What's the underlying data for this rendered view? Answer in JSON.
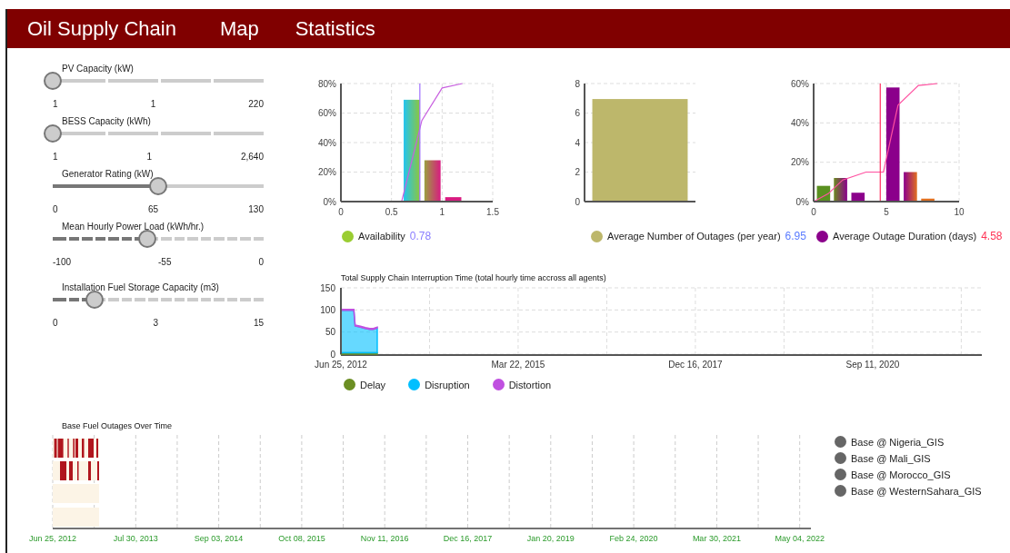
{
  "header": {
    "title": "Oil Supply Chain",
    "nav": [
      "Map",
      "Statistics"
    ]
  },
  "sliders": [
    {
      "label": "PV Capacity (kW)",
      "kind": "segmented",
      "level": 0,
      "min": "1",
      "mid": "1",
      "max": "220"
    },
    {
      "label": "BESS Capacity (kWh)",
      "kind": "segmented",
      "level": 0,
      "min": "1",
      "mid": "1",
      "max": "2,640"
    },
    {
      "label": "Generator Rating (kW)",
      "kind": "plain",
      "level": 0.5,
      "min": "0",
      "mid": "65",
      "max": "130"
    },
    {
      "label": "Mean Hourly Power Load (kWh/hr.)",
      "kind": "dashed",
      "level": 0.45,
      "min": "-100",
      "mid": "-55",
      "max": "0"
    },
    {
      "label": "Installation Fuel Storage Capacity (m3)",
      "kind": "dashed",
      "level": 0.2,
      "min": "0",
      "mid": "3",
      "max": "15"
    }
  ],
  "histograms": [
    {
      "legend": {
        "label": "Availability",
        "color": "#9acd32",
        "value": {
          "text": "0.78",
          "color": "#8a7dff"
        }
      },
      "chart_data": {
        "type": "bar",
        "xlim": [
          0,
          1.5
        ],
        "ylim": [
          0,
          80
        ],
        "xticks": [
          0,
          0.5,
          1,
          1.5
        ],
        "yticks": [
          {
            "value": 0,
            "label": "0%"
          },
          {
            "value": 20,
            "label": "20%"
          },
          {
            "value": 40,
            "label": "40%"
          },
          {
            "value": 60,
            "label": "60%"
          },
          {
            "value": 80,
            "label": "80%"
          }
        ],
        "grid": true,
        "series": [
          {
            "type": "bar",
            "x": [
              0.7,
              0.905,
              1.11
            ],
            "values": [
              69,
              28,
              3
            ]
          },
          {
            "type": "line",
            "color": "#c860e0",
            "x": [
              0.6,
              0.8,
              1.0,
              1.2
            ],
            "values": [
              0,
              55,
              77,
              80
            ]
          }
        ],
        "ref_lines": [
          {
            "axis": "x",
            "value": 0.78,
            "color": "#a070ff"
          }
        ]
      }
    },
    {
      "legend": {
        "label": "Average Number of Outages (per year)",
        "color": "#bdb76b",
        "value": {
          "text": "6.95",
          "color": "#5b7cff"
        }
      },
      "chart_data": {
        "type": "bar",
        "categories": [
          null
        ],
        "ylim": [
          0,
          8
        ],
        "yticks": [
          0,
          2,
          4,
          6,
          8
        ],
        "grid": true,
        "series": [
          {
            "values": [
              6.95
            ]
          }
        ]
      }
    },
    {
      "legend": {
        "label": "Average Outage Duration (days)",
        "color": "#8b008b",
        "value": {
          "text": "4.58",
          "color": "#ff3355"
        }
      },
      "chart_data": {
        "type": "bar",
        "xlim": [
          0,
          10
        ],
        "ylim": [
          0,
          60
        ],
        "xticks": [
          0,
          5,
          10
        ],
        "yticks": [
          {
            "value": 0,
            "label": "0%"
          },
          {
            "value": 20,
            "label": "20%"
          },
          {
            "value": 40,
            "label": "40%"
          },
          {
            "value": 60,
            "label": "60%"
          }
        ],
        "grid": true,
        "series": [
          {
            "type": "bar",
            "x": [
              0.68,
              1.85,
              3.05,
              5.45,
              6.65,
              7.85
            ],
            "values": [
              8,
              12,
              4.5,
              58,
              15,
              1.5
            ]
          },
          {
            "type": "line",
            "color": "#ff50a0",
            "x": [
              0,
              1,
              2,
              3.6,
              4.8,
              5.8,
              7.2,
              8.5
            ],
            "values": [
              0,
              4,
              11,
              15,
              15,
              49,
              59,
              60
            ]
          }
        ],
        "ref_lines": [
          {
            "axis": "x",
            "value": 4.58,
            "color": "#ff3060"
          }
        ]
      }
    }
  ],
  "interruption": {
    "chart_data": {
      "type": "area",
      "title": "Total Supply Chain Interruption Time (total hourly time accross all agents)",
      "stacked": true,
      "grid": true,
      "xlim": [
        "2012-06-25",
        "2022-05-20"
      ],
      "ylim": [
        0,
        150
      ],
      "yticks": [
        0,
        50,
        100,
        150
      ],
      "xticks": [
        {
          "value": "2012-06-25",
          "label": "Jun 25, 2012"
        },
        {
          "value": "2015-03-22",
          "label": "Mar 22, 2015"
        },
        {
          "value": "2017-12-16",
          "label": "Dec 16, 2017"
        },
        {
          "value": "2020-09-11",
          "label": "Sep 11, 2020"
        }
      ],
      "x": [
        "2012-06-25",
        "2012-07-02",
        "2012-07-13",
        "2012-09-06",
        "2012-09-13",
        "2012-10-13",
        "2012-11-10",
        "2012-12-05",
        "2012-12-25",
        "2013-01-16"
      ],
      "series": [
        {
          "name": "Delay",
          "color": "#6b8e23",
          "values": [
            3,
            3,
            3,
            3,
            3,
            3,
            3,
            3,
            3,
            3
          ]
        },
        {
          "name": "Disruption",
          "color": "#00bfff",
          "values": [
            98,
            96,
            96,
            96,
            61,
            58,
            55,
            53,
            53,
            56
          ]
        },
        {
          "name": "Distortion",
          "color": "#c050e0",
          "values": [
            2,
            2,
            2,
            2,
            2,
            2,
            2,
            2,
            2,
            2
          ]
        }
      ]
    }
  },
  "timeline": {
    "title": "Base Fuel Outages Over Time",
    "x_labels": [
      "Jun 25, 2012",
      "Jul 30, 2013",
      "Sep 03, 2014",
      "Oct 08, 2015",
      "Nov 11, 2016",
      "Dec 16, 2017",
      "Jan 20, 2019",
      "Feb 24, 2020",
      "Mar 30, 2021",
      "May 04, 2022"
    ],
    "legend": [
      {
        "label": "Base @ Nigeria_GIS"
      },
      {
        "label": "Base @ Mali_GIS"
      },
      {
        "label": "Base @ Morocco_GIS"
      },
      {
        "label": "Base @ WesternSahara_GIS"
      }
    ]
  }
}
